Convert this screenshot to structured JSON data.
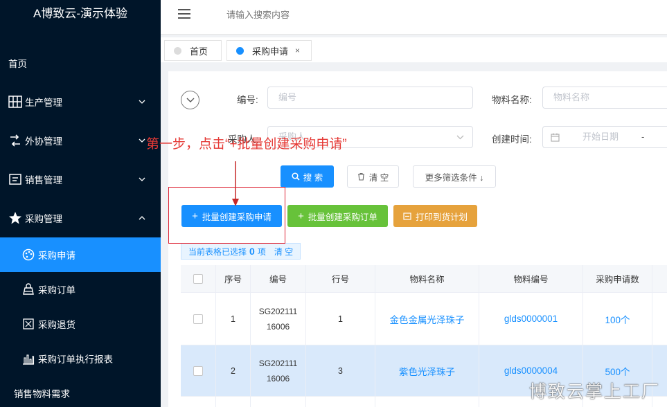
{
  "app": {
    "brand": "A博致云-演示体验"
  },
  "sidebar": {
    "items": [
      {
        "label": "首页",
        "icon": ""
      },
      {
        "label": "生产管理",
        "icon": "grid-icon",
        "expand": "down"
      },
      {
        "label": "外协管理",
        "icon": "share-icon",
        "expand": "down"
      },
      {
        "label": "销售管理",
        "icon": "sale-icon",
        "expand": "down"
      },
      {
        "label": "采购管理",
        "icon": "star-icon",
        "expand": "up"
      }
    ],
    "subitems": [
      {
        "label": "采购申请",
        "icon": "palette-icon",
        "active": true
      },
      {
        "label": "采购订单",
        "icon": "bag-icon"
      },
      {
        "label": "采购退货",
        "icon": "return-icon"
      },
      {
        "label": "采购订单执行报表",
        "icon": "chart-icon"
      }
    ],
    "extra": "销售物料需求"
  },
  "topbar": {
    "search_placeholder": "请输入搜索内容"
  },
  "tabs": [
    {
      "label": "首页",
      "active": false
    },
    {
      "label": "采购申请",
      "active": true,
      "close": "×"
    }
  ],
  "filters": {
    "no_label": "编号:",
    "no_placeholder": "编号",
    "material_label": "物料名称:",
    "material_placeholder": "物料名称",
    "purchase_label": "采购人:",
    "purchase_placeholder": "采购人",
    "created_label": "创建时间:",
    "start_placeholder": "开始日期",
    "date_sep": "-"
  },
  "buttons": {
    "search": "搜 索",
    "clear": "清 空",
    "more": "更多筛选条件 ↓",
    "batch_request": "批量创建采购申请",
    "batch_order": "批量创建采购订单",
    "print": "打印到货计划"
  },
  "selection": {
    "prefix": "当前表格已选择",
    "count": "0",
    "suffix": "项",
    "clear": "清 空"
  },
  "table": {
    "headers": [
      "序号",
      "编号",
      "行号",
      "物料名称",
      "物料编号",
      "采购申请数"
    ],
    "rows": [
      {
        "seq": "1",
        "code_1": "SG202111",
        "code_2": "16006",
        "line": "1",
        "name": "金色金属光泽珠子",
        "mat_no": "glds0000001",
        "qty": "100个"
      },
      {
        "seq": "2",
        "code_1": "SG202111",
        "code_2": "16006",
        "line": "3",
        "name": "紫色光泽珠子",
        "mat_no": "glds0000004",
        "qty": "500个"
      }
    ]
  },
  "annotation": {
    "text": "第一步，点击“+批量创建采购申请”"
  },
  "watermark": "博致云掌上工厂",
  "colors": {
    "sidebar": "#001529",
    "accent": "#1890ff",
    "success": "#67c23a",
    "warning": "#e6a23c",
    "annotation": "#e53935"
  }
}
